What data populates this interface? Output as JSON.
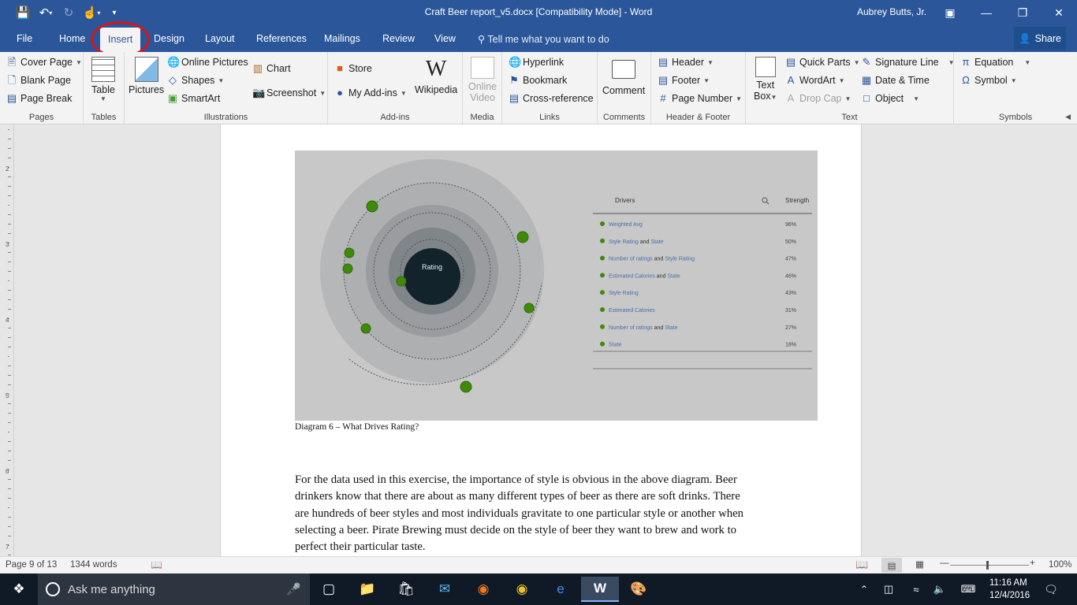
{
  "window": {
    "title": "Craft Beer report_v5.docx [Compatibility Mode] - Word",
    "user": "Aubrey Butts, Jr."
  },
  "tabs": [
    "File",
    "Home",
    "Insert",
    "Design",
    "Layout",
    "References",
    "Mailings",
    "Review",
    "View"
  ],
  "active_tab": "Insert",
  "tell_me": "Tell me what you want to do",
  "share": "Share",
  "ribbon": {
    "pages": {
      "label": "Pages",
      "cover_page": "Cover Page",
      "blank_page": "Blank Page",
      "page_break": "Page Break"
    },
    "tables": {
      "label": "Tables",
      "table": "Table"
    },
    "illustrations": {
      "label": "Illustrations",
      "pictures": "Pictures",
      "online_pictures": "Online Pictures",
      "shapes": "Shapes",
      "smartart": "SmartArt",
      "chart": "Chart",
      "screenshot": "Screenshot"
    },
    "addins": {
      "label": "Add-ins",
      "store": "Store",
      "my_addins": "My Add-ins",
      "wikipedia": "Wikipedia"
    },
    "media": {
      "label": "Media",
      "online": "Online",
      "video": "Video"
    },
    "links": {
      "label": "Links",
      "hyperlink": "Hyperlink",
      "bookmark": "Bookmark",
      "cross_reference": "Cross-reference"
    },
    "comments": {
      "label": "Comments",
      "comment": "Comment"
    },
    "header_footer": {
      "label": "Header & Footer",
      "header": "Header",
      "footer": "Footer",
      "page_number": "Page Number"
    },
    "text": {
      "label": "Text",
      "text": "Text",
      "box": "Box",
      "quick_parts": "Quick Parts",
      "wordart": "WordArt",
      "drop_cap": "Drop Cap",
      "signature_line": "Signature Line",
      "date_time": "Date & Time",
      "object": "Object"
    },
    "symbols": {
      "label": "Symbols",
      "equation": "Equation",
      "symbol": "Symbol"
    }
  },
  "ruler_numbers": [
    "2",
    "3",
    "4",
    "5",
    "6",
    "7"
  ],
  "diagram": {
    "center": "Rating",
    "col_drivers": "Drivers",
    "col_strength": "Strength",
    "rows": [
      {
        "parts": [
          [
            "Weighted Avg",
            "link"
          ]
        ],
        "value": "96%"
      },
      {
        "parts": [
          [
            "Style Rating",
            "link"
          ],
          [
            " and ",
            "plain"
          ],
          [
            "State",
            "link"
          ]
        ],
        "value": "50%"
      },
      {
        "parts": [
          [
            "Number of ratings",
            "link"
          ],
          [
            " and ",
            "plain"
          ],
          [
            "Style Rating",
            "link"
          ]
        ],
        "value": "47%"
      },
      {
        "parts": [
          [
            "Estimated Calories",
            "link"
          ],
          [
            " and ",
            "plain"
          ],
          [
            "State",
            "link"
          ]
        ],
        "value": "46%"
      },
      {
        "parts": [
          [
            "Style Rating",
            "link"
          ]
        ],
        "value": "43%"
      },
      {
        "parts": [
          [
            "Estimated Calories",
            "link"
          ]
        ],
        "value": "31%"
      },
      {
        "parts": [
          [
            "Number of ratings",
            "link"
          ],
          [
            " and ",
            "plain"
          ],
          [
            "State",
            "link"
          ]
        ],
        "value": "27%"
      },
      {
        "parts": [
          [
            "State",
            "link"
          ]
        ],
        "value": "18%"
      }
    ]
  },
  "caption": "Diagram 6 – What Drives Rating?",
  "body_lines": [
    "For the data used in this exercise, the importance of style is obvious in the above diagram.  Beer",
    "drinkers know that there are about as many different types of beer as there are soft drinks.  There",
    "are hundreds of beer styles and most individuals gravitate to one particular style or another when",
    "selecting a beer.  Pirate Brewing must decide on the style of beer they want to brew and work to",
    "perfect their particular taste."
  ],
  "status": {
    "page": "Page 9 of 13",
    "words": "1344 words",
    "zoom": "100%"
  },
  "taskbar": {
    "search": "Ask me anything",
    "time": "11:16 AM",
    "date": "12/4/2016"
  },
  "colors": {
    "word_blue": "#2b579a",
    "insert_circle": "#d8141a",
    "node_green": "#3f8a0a"
  }
}
